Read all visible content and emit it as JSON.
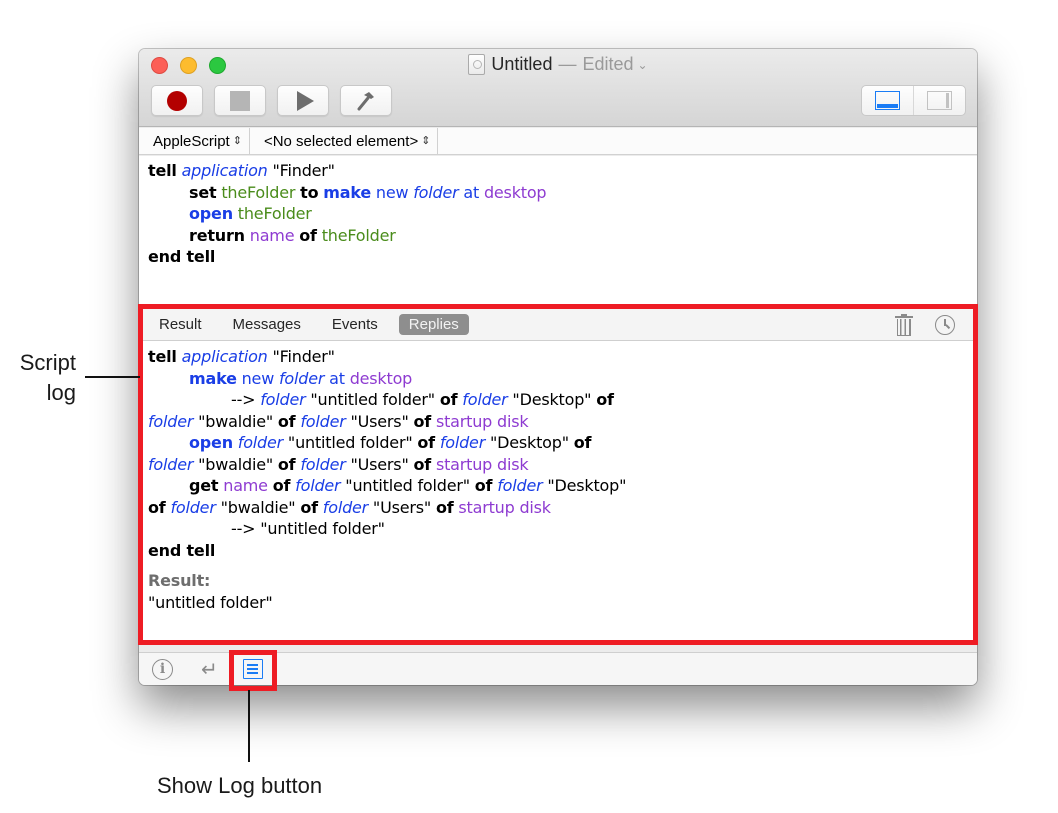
{
  "window": {
    "title": "Untitled",
    "title_separator": "—",
    "edited_label": "Edited",
    "title_chevron": "⌄",
    "title_icon": "document-icon"
  },
  "toolbar": {
    "buttons": [
      {
        "name": "record",
        "icon": "record-icon"
      },
      {
        "name": "stop",
        "icon": "stop-icon"
      },
      {
        "name": "run",
        "icon": "play-icon"
      },
      {
        "name": "compile",
        "icon": "hammer-icon"
      }
    ],
    "view_toggle": [
      {
        "name": "show-bottom-pane",
        "icon": "bottom-pane-icon",
        "selected": true
      },
      {
        "name": "show-side-pane",
        "icon": "side-pane-icon",
        "selected": false
      }
    ]
  },
  "navbar": {
    "language": "AppleScript",
    "element": "<No selected element>",
    "updown_glyph": "⌃⌄"
  },
  "editor": {
    "lines": [
      {
        "indent": 0,
        "tokens": [
          {
            "t": "tell",
            "c": "kw"
          },
          {
            "t": " ",
            "c": "str"
          },
          {
            "t": "application",
            "c": "cls"
          },
          {
            "t": " \"Finder\"",
            "c": "str"
          }
        ]
      },
      {
        "indent": 1,
        "tokens": [
          {
            "t": "set",
            "c": "kw"
          },
          {
            "t": " ",
            "c": "str"
          },
          {
            "t": "theFolder",
            "c": "var"
          },
          {
            "t": " ",
            "c": "str"
          },
          {
            "t": "to",
            "c": "kw"
          },
          {
            "t": " ",
            "c": "str"
          },
          {
            "t": "make",
            "c": "bkw"
          },
          {
            "t": " new ",
            "c": "cmd"
          },
          {
            "t": "folder",
            "c": "cls"
          },
          {
            "t": " at ",
            "c": "cmd"
          },
          {
            "t": "desktop",
            "c": "prop"
          }
        ]
      },
      {
        "indent": 1,
        "tokens": [
          {
            "t": "open",
            "c": "bkw"
          },
          {
            "t": " ",
            "c": "str"
          },
          {
            "t": "theFolder",
            "c": "var"
          }
        ]
      },
      {
        "indent": 1,
        "tokens": [
          {
            "t": "return",
            "c": "kw"
          },
          {
            "t": " ",
            "c": "str"
          },
          {
            "t": "name",
            "c": "prop"
          },
          {
            "t": " ",
            "c": "str"
          },
          {
            "t": "of",
            "c": "kw"
          },
          {
            "t": " ",
            "c": "str"
          },
          {
            "t": "theFolder",
            "c": "var"
          }
        ]
      },
      {
        "indent": 0,
        "tokens": [
          {
            "t": "end tell",
            "c": "kw"
          }
        ]
      }
    ]
  },
  "log": {
    "tabs": [
      {
        "label": "Result",
        "active": false
      },
      {
        "label": "Messages",
        "active": false
      },
      {
        "label": "Events",
        "active": false
      },
      {
        "label": "Replies",
        "active": true
      }
    ],
    "tools": [
      "trash-icon",
      "clock-icon"
    ],
    "lines": [
      {
        "indent": 0,
        "tokens": [
          {
            "t": "tell",
            "c": "kw"
          },
          {
            "t": " ",
            "c": "str"
          },
          {
            "t": "application",
            "c": "cls"
          },
          {
            "t": " \"Finder\"",
            "c": "str"
          }
        ]
      },
      {
        "indent": 1,
        "tokens": [
          {
            "t": "make",
            "c": "bkw"
          },
          {
            "t": " new ",
            "c": "cmd"
          },
          {
            "t": "folder",
            "c": "cls"
          },
          {
            "t": " at ",
            "c": "cmd"
          },
          {
            "t": "desktop",
            "c": "prop"
          }
        ]
      },
      {
        "indent": 2,
        "tokens": [
          {
            "t": "--> ",
            "c": "str"
          },
          {
            "t": "folder",
            "c": "cls"
          },
          {
            "t": " \"untitled folder\" ",
            "c": "str"
          },
          {
            "t": "of",
            "c": "kw"
          },
          {
            "t": " ",
            "c": "str"
          },
          {
            "t": "folder",
            "c": "cls"
          },
          {
            "t": " \"Desktop\" ",
            "c": "str"
          },
          {
            "t": "of",
            "c": "kw"
          }
        ]
      },
      {
        "indent": 0,
        "tokens": [
          {
            "t": "folder",
            "c": "cls"
          },
          {
            "t": " \"bwaldie\" ",
            "c": "str"
          },
          {
            "t": "of",
            "c": "kw"
          },
          {
            "t": " ",
            "c": "str"
          },
          {
            "t": "folder",
            "c": "cls"
          },
          {
            "t": " \"Users\" ",
            "c": "str"
          },
          {
            "t": "of",
            "c": "kw"
          },
          {
            "t": " ",
            "c": "str"
          },
          {
            "t": "startup disk",
            "c": "prop"
          }
        ]
      },
      {
        "indent": 1,
        "tokens": [
          {
            "t": "open",
            "c": "bkw"
          },
          {
            "t": " ",
            "c": "str"
          },
          {
            "t": "folder",
            "c": "cls"
          },
          {
            "t": " \"untitled folder\" ",
            "c": "str"
          },
          {
            "t": "of",
            "c": "kw"
          },
          {
            "t": " ",
            "c": "str"
          },
          {
            "t": "folder",
            "c": "cls"
          },
          {
            "t": " \"Desktop\" ",
            "c": "str"
          },
          {
            "t": "of",
            "c": "kw"
          }
        ]
      },
      {
        "indent": 0,
        "tokens": [
          {
            "t": "folder",
            "c": "cls"
          },
          {
            "t": " \"bwaldie\" ",
            "c": "str"
          },
          {
            "t": "of",
            "c": "kw"
          },
          {
            "t": " ",
            "c": "str"
          },
          {
            "t": "folder",
            "c": "cls"
          },
          {
            "t": " \"Users\" ",
            "c": "str"
          },
          {
            "t": "of",
            "c": "kw"
          },
          {
            "t": " ",
            "c": "str"
          },
          {
            "t": "startup disk",
            "c": "prop"
          }
        ]
      },
      {
        "indent": 1,
        "tokens": [
          {
            "t": "get",
            "c": "kw"
          },
          {
            "t": " ",
            "c": "str"
          },
          {
            "t": "name",
            "c": "prop"
          },
          {
            "t": " ",
            "c": "str"
          },
          {
            "t": "of",
            "c": "kw"
          },
          {
            "t": " ",
            "c": "str"
          },
          {
            "t": "folder",
            "c": "cls"
          },
          {
            "t": " \"untitled folder\" ",
            "c": "str"
          },
          {
            "t": "of",
            "c": "kw"
          },
          {
            "t": " ",
            "c": "str"
          },
          {
            "t": "folder",
            "c": "cls"
          },
          {
            "t": " \"Desktop\"",
            "c": "str"
          }
        ]
      },
      {
        "indent": 0,
        "tokens": [
          {
            "t": "of",
            "c": "kw"
          },
          {
            "t": " ",
            "c": "str"
          },
          {
            "t": "folder",
            "c": "cls"
          },
          {
            "t": " \"bwaldie\" ",
            "c": "str"
          },
          {
            "t": "of",
            "c": "kw"
          },
          {
            "t": " ",
            "c": "str"
          },
          {
            "t": "folder",
            "c": "cls"
          },
          {
            "t": " \"Users\" ",
            "c": "str"
          },
          {
            "t": "of",
            "c": "kw"
          },
          {
            "t": " ",
            "c": "str"
          },
          {
            "t": "startup disk",
            "c": "prop"
          }
        ]
      },
      {
        "indent": 2,
        "tokens": [
          {
            "t": "--> \"untitled folder\"",
            "c": "str"
          }
        ]
      },
      {
        "indent": 0,
        "tokens": [
          {
            "t": "end tell",
            "c": "kw"
          }
        ]
      }
    ],
    "result_label": "Result:",
    "result_value": "\"untitled folder\""
  },
  "bottombar": {
    "info_glyph": "i",
    "return_glyph": "↵",
    "buttons": [
      "info-icon",
      "return-icon",
      "show-log-icon"
    ]
  },
  "annotations": {
    "script_log": "Script log",
    "script_log_line1": "Script",
    "script_log_line2": "log",
    "show_log_button": "Show Log button",
    "highlight_color": "#ee1c24"
  },
  "colors": {
    "keyword": "#000000",
    "command_bold": "#1a3ee6",
    "class": "#1a3ee6",
    "property": "#8e3bd1",
    "variable": "#4a8c1b",
    "accent": "#1a7cf5",
    "record": "#b30000"
  }
}
